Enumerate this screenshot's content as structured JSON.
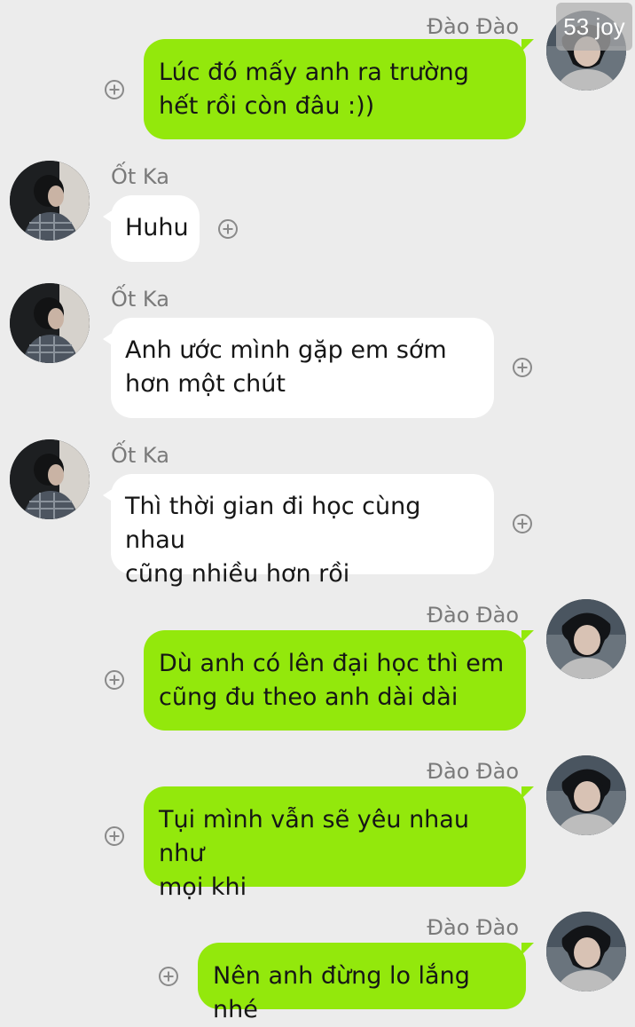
{
  "conversation": {
    "messages": [
      {
        "sender": "Đào Đào",
        "side": "right",
        "text": "Lúc đó mấy anh ra trường\nhết rồi còn đâu :))"
      },
      {
        "sender": "Ốt Ka",
        "side": "left",
        "text": "Huhu"
      },
      {
        "sender": "Ốt Ka",
        "side": "left",
        "text": "Anh ước mình gặp em sớm\nhơn một chút"
      },
      {
        "sender": "Ốt Ka",
        "side": "left",
        "text": "Thì thời gian đi học cùng nhau\ncũng nhiều hơn rồi"
      },
      {
        "sender": "Đào Đào",
        "side": "right",
        "text": "Dù anh có lên đại học thì em\ncũng đu theo anh dài dài"
      },
      {
        "sender": "Đào Đào",
        "side": "right",
        "text": "Tụi mình vẫn sẽ yêu nhau như\nmọi khi"
      },
      {
        "sender": "Đào Đào",
        "side": "right",
        "text": "Nên anh đừng lo lắng nhé"
      }
    ]
  },
  "overlay": {
    "badge_text": "53 joy"
  },
  "colors": {
    "background": "#ececec",
    "outgoing_bubble": "#93e80c",
    "incoming_bubble": "#ffffff",
    "sender_name": "#7a7a7a"
  },
  "icons": {
    "reaction": "add-circle-icon"
  }
}
